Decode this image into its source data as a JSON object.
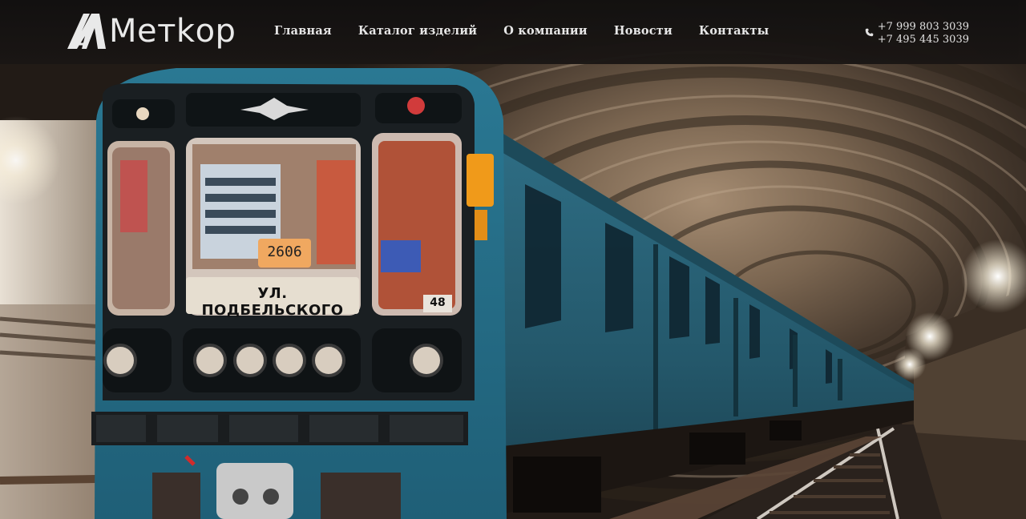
{
  "brand": {
    "logo_text": "Метkор"
  },
  "nav": {
    "items": [
      {
        "label": "Главная"
      },
      {
        "label": "Каталог изделий"
      },
      {
        "label": "О компании"
      },
      {
        "label": "Новости"
      },
      {
        "label": "Контакты"
      }
    ]
  },
  "contacts": {
    "phone_1": "+7 999 803 3039",
    "phone_2": "+7 495 445 3039"
  },
  "hero": {
    "route_sign": "УЛ. ПОДБЕЛЬСКОГО",
    "car_number": "2606",
    "train_code": "48"
  },
  "icons": {
    "phone": "phone-icon"
  },
  "colors": {
    "header_bg": "#141110",
    "train_blue": "#2b7a96",
    "nav_text": "#efefef"
  }
}
